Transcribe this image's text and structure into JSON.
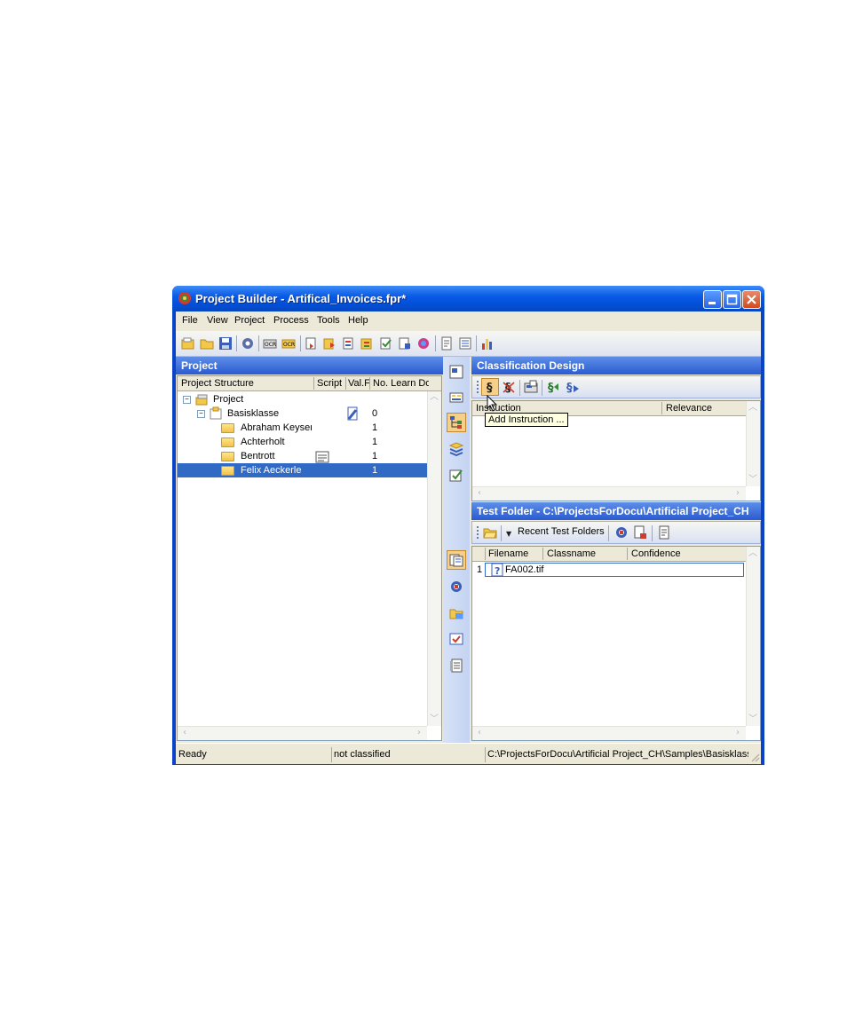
{
  "window": {
    "title": "Project Builder - Artifical_Invoices.fpr*"
  },
  "menu": [
    "File",
    "View",
    "Project",
    "Process",
    "Tools",
    "Help"
  ],
  "project_panel": {
    "header": "Project",
    "columns": [
      "Project Structure",
      "Script",
      "Val.F",
      "No. Learn Do"
    ],
    "tree": {
      "root": "Project",
      "class": {
        "name": "Basisklasse",
        "count": "0"
      },
      "folders": [
        {
          "name": "Abraham Keyser",
          "count": "1"
        },
        {
          "name": "Achterholt",
          "count": "1"
        },
        {
          "name": "Bentrott",
          "count": "1"
        },
        {
          "name": "Felix Aeckerle",
          "count": "1"
        }
      ]
    }
  },
  "classification_panel": {
    "header": "Classification Design",
    "columns": [
      "Instruction",
      "Relevance"
    ],
    "tooltip": "Add Instruction ..."
  },
  "test_folder_panel": {
    "header": "Test Folder - C:\\ProjectsForDocu\\Artificial Project_CH",
    "recent_label": "Recent Test Folders",
    "columns": [
      "Filename",
      "Classname",
      "Confidence"
    ],
    "rows": [
      {
        "index": "1",
        "filename": "FA002.tif"
      }
    ]
  },
  "status": {
    "left": "Ready",
    "middle": "not classified",
    "right": "C:\\ProjectsForDocu\\Artificial Project_CH\\Samples\\Basisklasse\\F"
  },
  "colors": {
    "title_blue": "#0a5be8",
    "selection": "#316ac5",
    "header_blue": "#2a5bd0",
    "close_red": "#d24a1c"
  }
}
